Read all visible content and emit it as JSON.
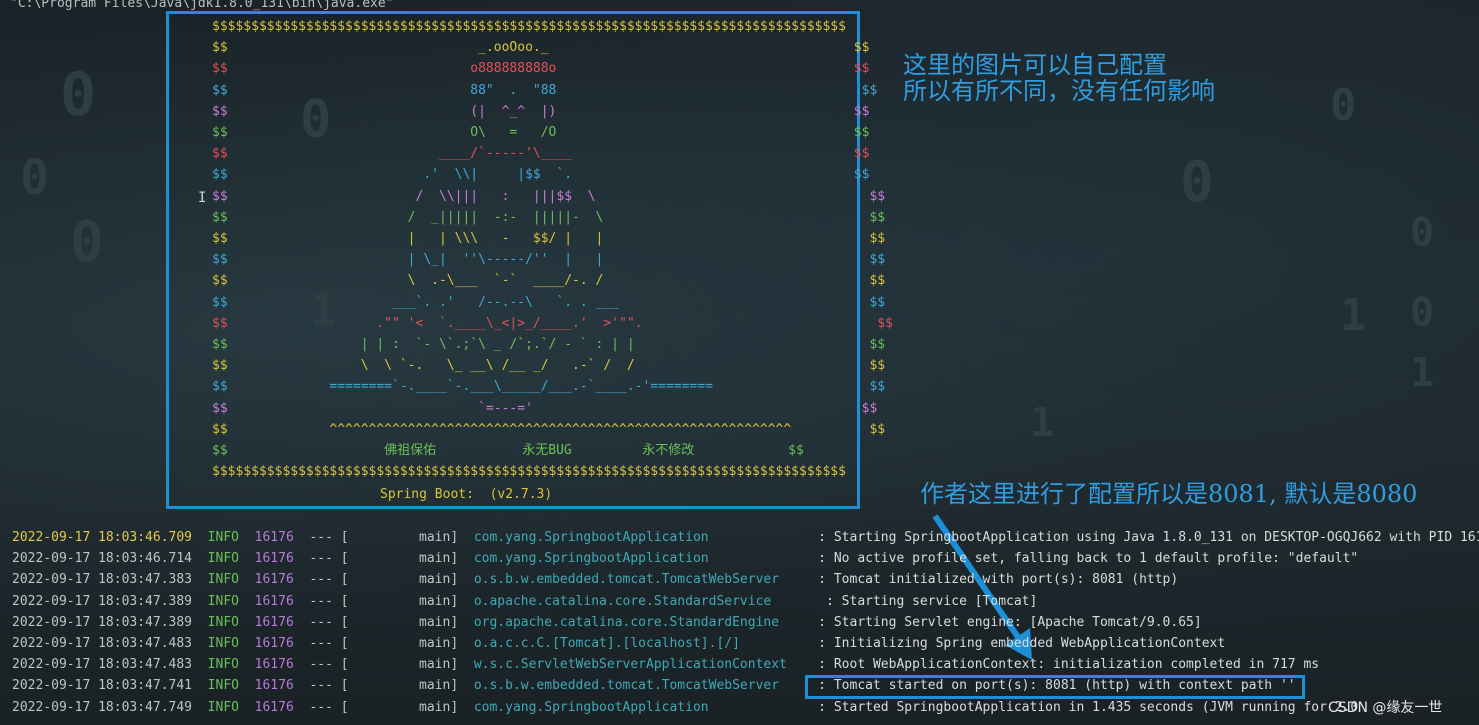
{
  "window": {
    "title": "\"C:\\Program Files\\Java\\jdk1.8.0_131\\bin\\java.exe\""
  },
  "banner": {
    "lines": [
      {
        "text": "$$$$$$$$$$$$$$$$$$$$$$$$$$$$$$$$$$$$$$$$$$$$$$$$$$$$$$$$$$$$$$$$$$$$$$$$$$$$$$$$$",
        "color": "#d9c43c"
      },
      {
        "text": "$$                                _.ooOoo._                                       $$",
        "color": "#d9c43c"
      },
      {
        "text": "$$                               o888888888o                                      $$",
        "color": "#e0505a"
      },
      {
        "text": "$$                               88\"  .  \"88                                       $$",
        "color": "#3fa9d8"
      },
      {
        "text": "$$                               (|  ^_^  |)                                      $$",
        "color": "#c77dd6"
      },
      {
        "text": "$$                               O\\   =   /O                                      $$",
        "color": "#6bbf59"
      },
      {
        "text": "$$                           ____/`-----'\\____                                    $$",
        "color": "#e0505a"
      },
      {
        "text": "$$                         .'  \\\\|     |$$  `.                                    $$",
        "color": "#3fa9d8"
      },
      {
        "text": "$$                        /  \\\\|||   :   |||$$  \\                                   $$",
        "color": "#c77dd6"
      },
      {
        "text": "$$                       /  _|||||  -:-  |||||-  \\                                  $$",
        "color": "#6bbf59"
      },
      {
        "text": "$$                       |   | \\\\\\   -   $$/ |   |                                  $$",
        "color": "#d9c43c"
      },
      {
        "text": "$$                       | \\_|  ''\\-----/''  |   |                                  $$",
        "color": "#3fa9d8"
      },
      {
        "text": "$$                       \\  .-\\___  `-`  ____/-. /                                  $$",
        "color": "#d9c43c"
      },
      {
        "text": "$$                     ___`. .'   /--.--\\   `. . ___                                $$",
        "color": "#3fa9d8"
      },
      {
        "text": "$$                   .\"\" '<  `.____\\_<|>_/____.'  >'\"\".                              $$",
        "color": "#e0505a"
      },
      {
        "text": "$$                 | | :  `- \\`.;`\\ _ /`;.`/ - ` : | |                              $$",
        "color": "#6bbf59"
      },
      {
        "text": "$$                 \\  \\ `-.   \\_ __\\ /__ _/   .-` /  /                              $$",
        "color": "#d9c43c"
      },
      {
        "text": "$$             ========`-.____`-.___\\_____/___.-`____.-'========                    $$",
        "color": "#3fa9d8"
      },
      {
        "text": "$$                                `=---='                                          $$",
        "color": "#c77dd6"
      },
      {
        "text": "$$             ^^^^^^^^^^^^^^^^^^^^^^^^^^^^^^^^^^^^^^^^^^^^^^^^^^^^^^^^^^^          $$",
        "color": "#d9c43c"
      },
      {
        "text": "$$                    佛祖保佑           永无BUG         永不修改            $$",
        "color": "#6bbf59"
      },
      {
        "text": "$$$$$$$$$$$$$$$$$$$$$$$$$$$$$$$$$$$$$$$$$$$$$$$$$$$$$$$$$$$$$$$$$$$$$$$$$$$$$$$$$",
        "color": "#d9c43c"
      }
    ],
    "spring_boot": "Spring Boot:  (v2.7.3)"
  },
  "annotations": {
    "top_line1": "这里的图片可以自己配置",
    "top_line2": "所以有所不同，没有任何影响",
    "port_note": "作者这里进行了配置所以是8081, 默认是8080"
  },
  "logs": [
    {
      "ts": "2022-09-17 18:03:46.709",
      "level": "INFO",
      "pid": "16176",
      "sep": "--- [",
      "thread": "         main]",
      "cls": "com.yang.SpringbootApplication             ",
      "msg": " : Starting SpringbootApplication using Java 1.8.0_131 on DESKTOP-OGQJ662 with PID 161",
      "first": true
    },
    {
      "ts": "2022-09-17 18:03:46.714",
      "level": "INFO",
      "pid": "16176",
      "sep": "--- [",
      "thread": "         main]",
      "cls": "com.yang.SpringbootApplication             ",
      "msg": " : No active profile set, falling back to 1 default profile: \"default\""
    },
    {
      "ts": "2022-09-17 18:03:47.383",
      "level": "INFO",
      "pid": "16176",
      "sep": "--- [",
      "thread": "         main]",
      "cls": "o.s.b.w.embedded.tomcat.TomcatWebServer    ",
      "msg": " : Tomcat initialized with port(s): 8081 (http)"
    },
    {
      "ts": "2022-09-17 18:03:47.389",
      "level": "INFO",
      "pid": "16176",
      "sep": "--- [",
      "thread": "         main]",
      "cls": "o.apache.catalina.core.StandardService      ",
      "msg": " : Starting service [Tomcat]"
    },
    {
      "ts": "2022-09-17 18:03:47.389",
      "level": "INFO",
      "pid": "16176",
      "sep": "--- [",
      "thread": "         main]",
      "cls": "org.apache.catalina.core.StandardEngine    ",
      "msg": " : Starting Servlet engine: [Apache Tomcat/9.0.65]"
    },
    {
      "ts": "2022-09-17 18:03:47.483",
      "level": "INFO",
      "pid": "16176",
      "sep": "--- [",
      "thread": "         main]",
      "cls": "o.a.c.c.C.[Tomcat].[localhost].[/]         ",
      "msg": " : Initializing Spring embedded WebApplicationContext"
    },
    {
      "ts": "2022-09-17 18:03:47.483",
      "level": "INFO",
      "pid": "16176",
      "sep": "--- [",
      "thread": "         main]",
      "cls": "w.s.c.ServletWebServerApplicationContext   ",
      "msg": " : Root WebApplicationContext: initialization completed in 717 ms"
    },
    {
      "ts": "2022-09-17 18:03:47.741",
      "level": "INFO",
      "pid": "16176",
      "sep": "--- [",
      "thread": "         main]",
      "cls": "o.s.b.w.embedded.tomcat.TomcatWebServer    ",
      "msg": " : Tomcat started on port(s): 8081 (http) with context path ''"
    },
    {
      "ts": "2022-09-17 18:03:47.749",
      "level": "INFO",
      "pid": "16176",
      "sep": "--- [",
      "thread": "         main]",
      "cls": "com.yang.SpringbootApplication             ",
      "msg": " : Started SpringbootApplication in 1.435 seconds (JVM running for 2.0"
    }
  ],
  "watermark": "CSDN @缘友一世",
  "colors": {
    "accent_box": "#1d8fd6",
    "annotation": "#2f9de0"
  }
}
